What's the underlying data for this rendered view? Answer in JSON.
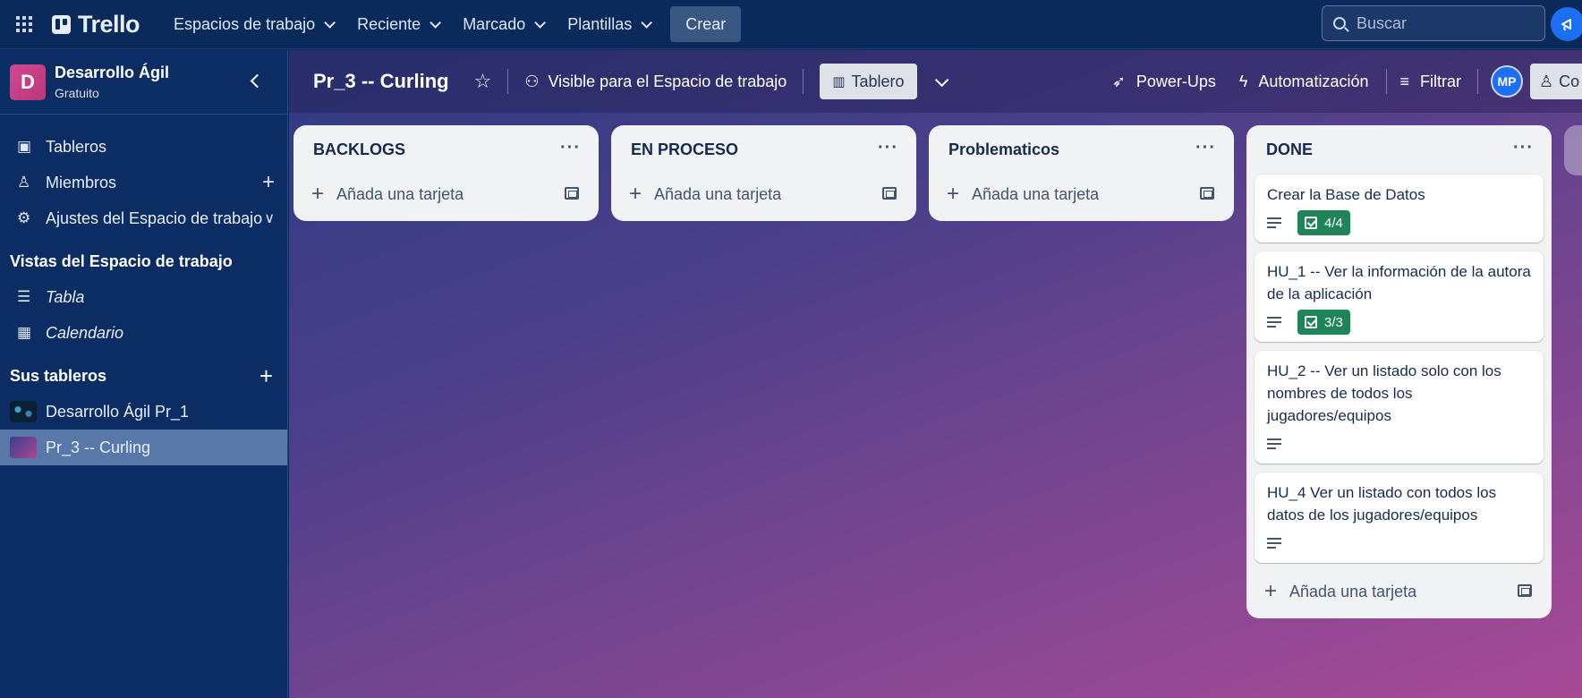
{
  "topnav": {
    "logo": "Trello",
    "menu": [
      {
        "label": "Espacios de trabajo"
      },
      {
        "label": "Reciente"
      },
      {
        "label": "Marcado"
      },
      {
        "label": "Plantillas"
      }
    ],
    "create_label": "Crear",
    "search_placeholder": "Buscar"
  },
  "sidebar": {
    "workspace_initial": "D",
    "workspace_name": "Desarrollo Ágil",
    "workspace_plan": "Gratuito",
    "items": [
      {
        "label": "Tableros",
        "icon": "board-icon"
      },
      {
        "label": "Miembros",
        "icon": "person-icon"
      },
      {
        "label": "Ajustes del Espacio de trabajo",
        "icon": "gear-icon"
      }
    ],
    "views_heading": "Vistas del Espacio de trabajo",
    "views": [
      {
        "label": "Tabla",
        "icon": "table-icon"
      },
      {
        "label": "Calendario",
        "icon": "calendar-icon"
      }
    ],
    "boards_heading": "Sus tableros",
    "boards": [
      {
        "label": "Desarrollo Ágil Pr_1"
      },
      {
        "label": "Pr_3 -- Curling"
      }
    ]
  },
  "board": {
    "title": "Pr_3 -- Curling",
    "visibility": "Visible para el Espacio de trabajo",
    "view_label": "Tablero",
    "powerups": "Power-Ups",
    "automation": "Automatización",
    "filter": "Filtrar",
    "member_initials": "MP",
    "share_label": "Co"
  },
  "add_card_label": "Añada una tarjeta",
  "lists": [
    {
      "title": "BACKLOGS",
      "cards": []
    },
    {
      "title": "EN PROCESO",
      "cards": []
    },
    {
      "title": "Problematicos",
      "cards": []
    },
    {
      "title": "DONE",
      "cards": [
        {
          "title": "Crear la Base de Datos",
          "checklist": "4/4"
        },
        {
          "title": "HU_1 -- Ver la información de la autora de la aplicación",
          "checklist": "3/3"
        },
        {
          "title": "HU_2 -- Ver un listado solo con los nombres de todos los jugadores/equipos",
          "checklist": null
        },
        {
          "title": "HU_4 Ver un listado con todos los datos de los jugadores/equipos",
          "checklist": null
        }
      ]
    }
  ],
  "colors": {
    "nav_bg": "#0b2a5c",
    "checklist_complete": "#1f845a",
    "accent": "#1d6ff2",
    "workspace_avatar": "#d2478f"
  }
}
